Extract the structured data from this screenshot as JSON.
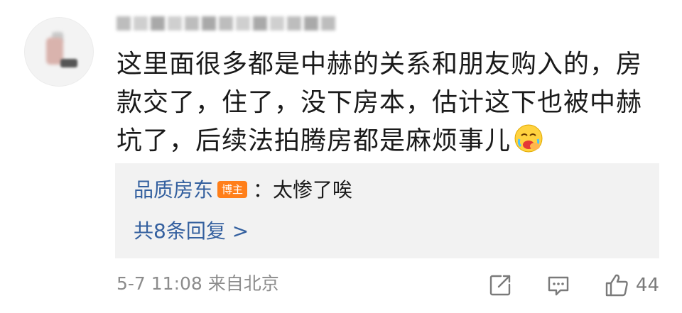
{
  "comment": {
    "avatar_icon": "blurred-avatar",
    "username": "",
    "text": "这里面很多都是中赫的关系和朋友购入的，房款交了，住了，没下房本，估计这下也被中赫坑了，后续法拍腾房都是麻烦事儿",
    "emoji": "crying-face-emoji"
  },
  "reply": {
    "user": "品质房东",
    "badge": "博主",
    "separator": "：",
    "text": "太惨了唉",
    "more_label": "共8条回复 >"
  },
  "footer": {
    "time": "5-7 11:08",
    "source": "来自北京"
  },
  "actions": {
    "share_icon": "share-icon",
    "comment_icon": "comment-icon",
    "like_icon": "thumbs-up-icon",
    "like_count": "44"
  },
  "colors": {
    "link": "#34609f",
    "badge": "#ff7f1a",
    "reply_bg": "#f2f2f2",
    "meta": "#8c8c8c"
  }
}
